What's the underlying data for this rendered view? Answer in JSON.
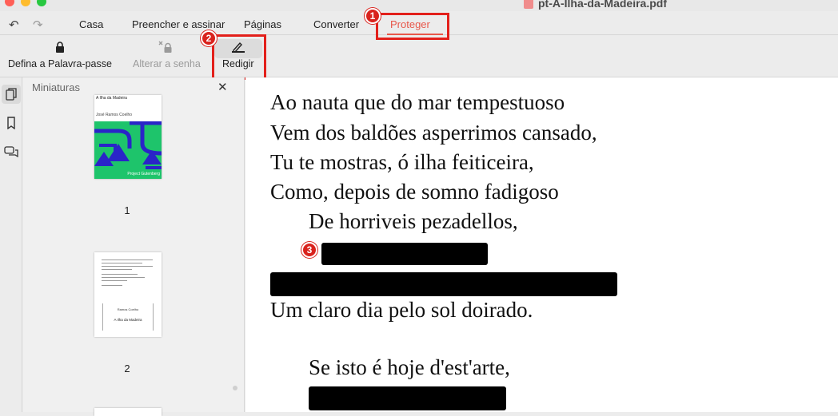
{
  "window": {
    "title": "pt-A-Ilha-da-Madeira.pdf"
  },
  "menu": {
    "items": [
      "Casa",
      "Preencher e assinar",
      "Páginas",
      "Converter",
      "Proteger"
    ],
    "active": "Proteger"
  },
  "toolbar": {
    "set_password": "Defina a Palavra-passe",
    "change_password": "Alterar a senha",
    "redact": "Redigir"
  },
  "annotations": [
    "1",
    "2",
    "3"
  ],
  "annotation_color": "#d9231d",
  "accent_color": "#e8574a",
  "thumbnails": {
    "title": "Miniaturas",
    "pages": [
      "1",
      "2"
    ],
    "cover": {
      "title": "A Ilha da Madeira",
      "author": "José Ramos Coelho",
      "footer": "Project Gutenberg",
      "background": "#1ec46b",
      "shape_color": "#2a24c8"
    },
    "page2": {
      "author": "Ramos Coelho",
      "title": "A Ilha da Madeira"
    }
  },
  "document": {
    "lines": [
      "Ao nauta que do mar tempestuoso",
      "Vem dos baldões asperrimos cansado,",
      "Tu te mostras, ó ilha feiticeira,",
      "Como, depois de somno fadigoso",
      "De horriveis pezadellos,",
      "Um claro dia pelo sol doirado.",
      "Se isto é hoje d'est'arte,"
    ]
  }
}
